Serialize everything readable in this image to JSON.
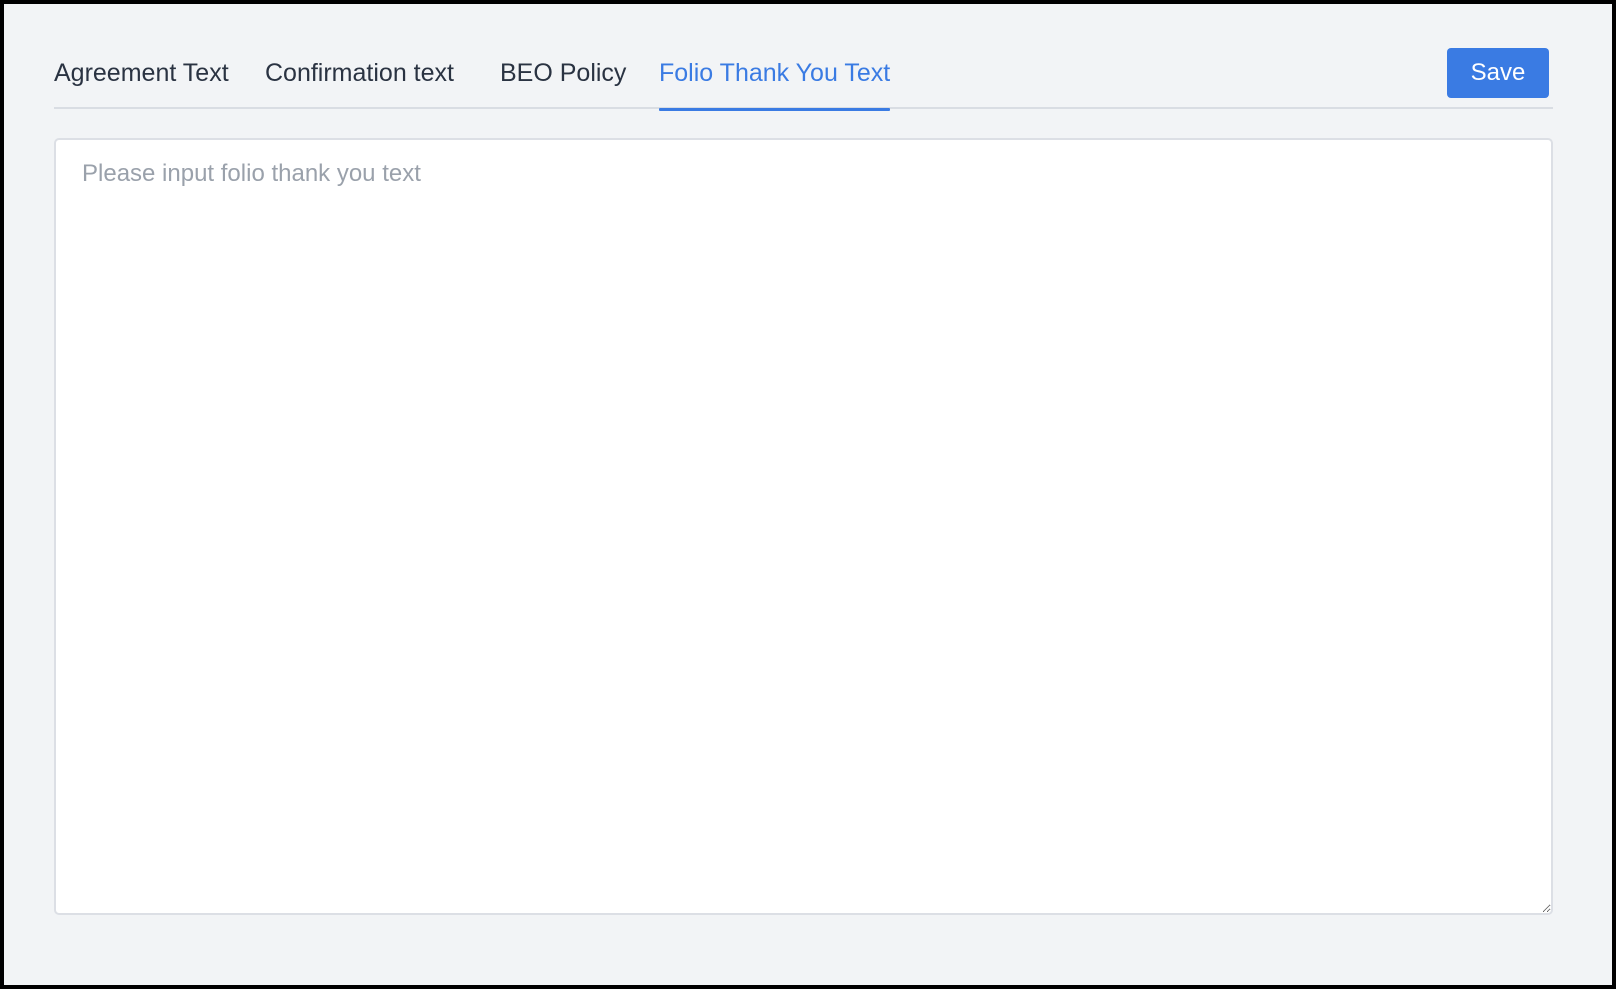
{
  "tabs": [
    {
      "label": "Agreement Text",
      "active": false
    },
    {
      "label": "Confirmation text",
      "active": false
    },
    {
      "label": "BEO Policy",
      "active": false
    },
    {
      "label": "Folio Thank You Text",
      "active": true
    }
  ],
  "toolbar": {
    "save_label": "Save"
  },
  "editor": {
    "value": "",
    "placeholder": "Please input folio thank you text"
  },
  "colors": {
    "accent": "#3a7be3",
    "background": "#f2f4f6",
    "text": "#2a3342",
    "placeholder": "#9aa1ab"
  }
}
